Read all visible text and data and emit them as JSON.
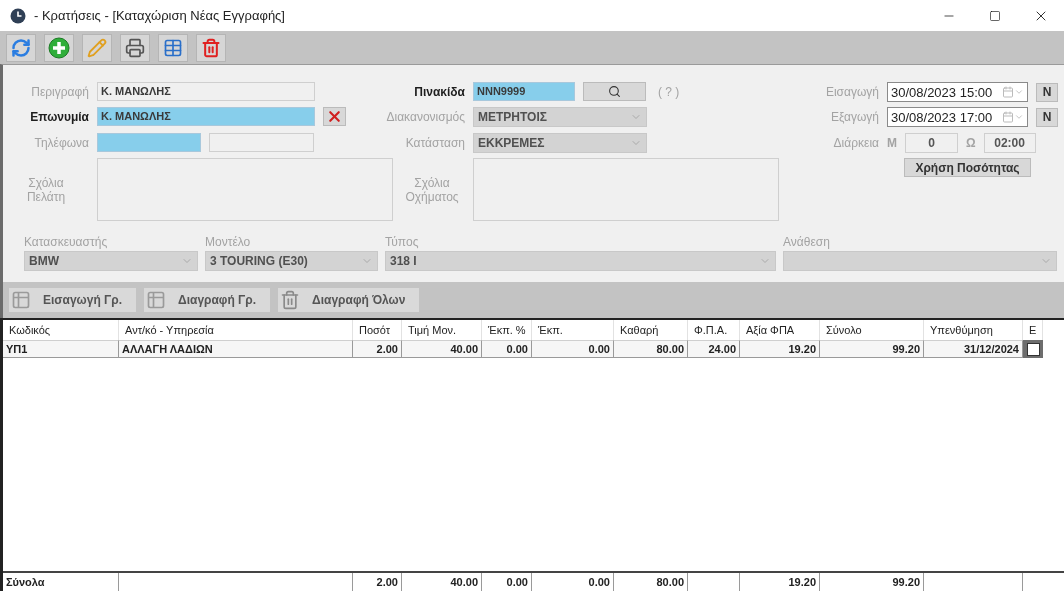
{
  "window": {
    "title": "- Κρατήσεις - [Καταχώριση Νέας Εγγραφής]"
  },
  "form": {
    "description": {
      "label": "Περιγραφή",
      "value": "Κ. ΜΑΝΩΛΗΣ",
      "required": false,
      "highlighted": false
    },
    "surname": {
      "label": "Επωνυμία",
      "value": "Κ. ΜΑΝΩΛΗΣ",
      "required": true,
      "highlighted": true
    },
    "phones": {
      "label": "Τηλέφωνα",
      "fields": [
        {
          "highlighted": true
        },
        {
          "highlighted": false
        }
      ]
    },
    "customer_comments": {
      "label": "Σχόλια Πελάτη"
    },
    "plate": {
      "label": "Πινακίδα",
      "value": "NNN9999",
      "required": true,
      "highlighted": true,
      "help": "( ? )"
    },
    "settlement": {
      "label": "Διακανονισμός",
      "value": "ΜΕΤΡΗΤΟΙΣ"
    },
    "status": {
      "label": "Κατάσταση",
      "value": "ΕΚΚΡΕΜΕΣ"
    },
    "vehicle_comments": {
      "label": "Σχόλια Οχήματος"
    },
    "entry": {
      "label": "Εισαγωγή",
      "value": "30/08/2023 15:00",
      "now_button": "N"
    },
    "exit": {
      "label": "Εξαγωγή",
      "value": "30/08/2023 17:00",
      "now_button": "N"
    },
    "duration": {
      "label": "Διάρκεια",
      "days_label": "Μ",
      "days": "0",
      "hours_label": "Ω",
      "hours": "02:00"
    },
    "use_quantity_button": "Χρήση Ποσότητας",
    "selectors": [
      {
        "label": "Κατασκευαστής",
        "value": "BMW"
      },
      {
        "label": "Μοντέλο",
        "value": "3 TOURING (E30)"
      },
      {
        "label": "Τύπος",
        "value": "318 I"
      },
      {
        "label": "Ανάθεση"
      }
    ]
  },
  "line_toolbar": [
    {
      "label": "Εισαγωγή Γρ.",
      "kind": "insert"
    },
    {
      "label": "Διαγραφή Γρ.",
      "kind": "delete"
    },
    {
      "label": "Διαγραφή Όλων",
      "kind": "clear"
    }
  ],
  "table": {
    "columns": [
      "Κωδικός",
      "Αντ/κό - Υπηρεσία",
      "Ποσότ",
      "Τιμή Μον.",
      "Έκπ. %",
      "Έκπ.",
      "Καθαρή",
      "Φ.Π.Α.",
      "Αξία ΦΠΑ",
      "Σύνολο",
      "Υπενθύμηση",
      "Ε"
    ],
    "rows": [
      {
        "cells": [
          "ΥΠ1",
          "ΑΛΛΑΓΗ ΛΑΔΙΩΝ",
          "2.00",
          "40.00",
          "0.00",
          "0.00",
          "80.00",
          "24.00",
          "19.20",
          "99.20",
          "31/12/2024"
        ],
        "checked": false
      }
    ],
    "totals": {
      "label": "Σύνολα",
      "quantity": "2.00",
      "unit_price": "40.00",
      "discount_pct": "0.00",
      "discount": "0.00",
      "net": "80.00",
      "vat_amount": "19.20",
      "total": "99.20"
    }
  }
}
